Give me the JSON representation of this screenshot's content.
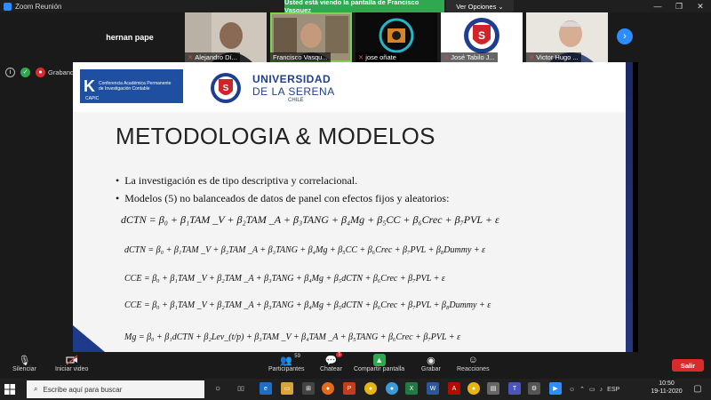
{
  "window": {
    "title": "Zoom Reunión",
    "share_banner": "Usted está viendo la pantalla de Francisco Vasquez",
    "view_options": "Ver Opciones ⌄",
    "controls": [
      "—",
      "❐",
      "✕"
    ]
  },
  "participants": {
    "name_only_tile": "hernan pape",
    "tiles": [
      {
        "name": "Alejandro Dí...",
        "mic_muted": true
      },
      {
        "name": "Francisco Vasqu...",
        "mic_muted": false
      },
      {
        "name": "jose oñate",
        "mic_muted": true
      },
      {
        "name": "José Tabilo J...",
        "mic_muted": true
      },
      {
        "name": "Victor Hugo ...",
        "mic_muted": true
      }
    ],
    "next_arrow": "›"
  },
  "status": {
    "recording_label": "Grabando"
  },
  "slide": {
    "capic_letter": "K",
    "capic_line1": "Conferencia Académica Permanente",
    "capic_line2": "de Investigación Contable",
    "capic_short": "CAPIC",
    "uni_line1": "UNIVERSIDAD",
    "uni_line2": "DE LA SERENA",
    "uni_line3": "CHILE",
    "title": "METODOLOGIA & MODELOS",
    "bullets": [
      "La investigación es de tipo descriptiva y correlacional.",
      "Modelos (5) no balanceados de datos de panel con efectos fijos y aleatorios:"
    ],
    "equations": [
      "dCTN = β₀ + β₁TAM _V + β₂TAM _A + β₃TANG + β₄Mg + β₅CC + β₆Crec + β₇PVL + ε",
      "dCTN = β₀ + β₁TAM _V + β₂TAM _A + β₃TANG + β₄Mg + β₅CC + β₆Crec + β₇PVL + β₈Dummy + ε",
      "CCE = β₀ + β₁TAM _V + β₂TAM _A + β₃TANG + β₄Mg + β₅dCTN + β₆Crec + β₇PVL + ε",
      "CCE = β₀ + β₁TAM _V + β₂TAM _A + β₃TANG + β₄Mg + β₅dCTN + β₆Crec + β₇PVL + β₈Dummy + ε",
      "Mg = β₀ + β₁dCTN + β₂Lev_(t/p) + β₃TAM _V + β₄TAM _A + β₅TANG + β₆Crec + β₇PVL + ε"
    ]
  },
  "toolbar": {
    "mute": "Silenciar",
    "video": "Iniciar video",
    "participants": "Participantes",
    "participants_count": "59",
    "chat": "Chatear",
    "chat_badge": "1",
    "share": "Compartir pantalla",
    "record": "Grabar",
    "reactions": "Reacciones",
    "leave": "Salir"
  },
  "taskbar": {
    "search_placeholder": "Escribe aquí para buscar",
    "language": "ESP",
    "time": "10:50",
    "date": "19-11-2020"
  },
  "colors": {
    "zoom_blue": "#2d8cff",
    "share_green": "#2fa84f",
    "leave_red": "#d92b2b",
    "uls_blue": "#1e3f8f"
  }
}
